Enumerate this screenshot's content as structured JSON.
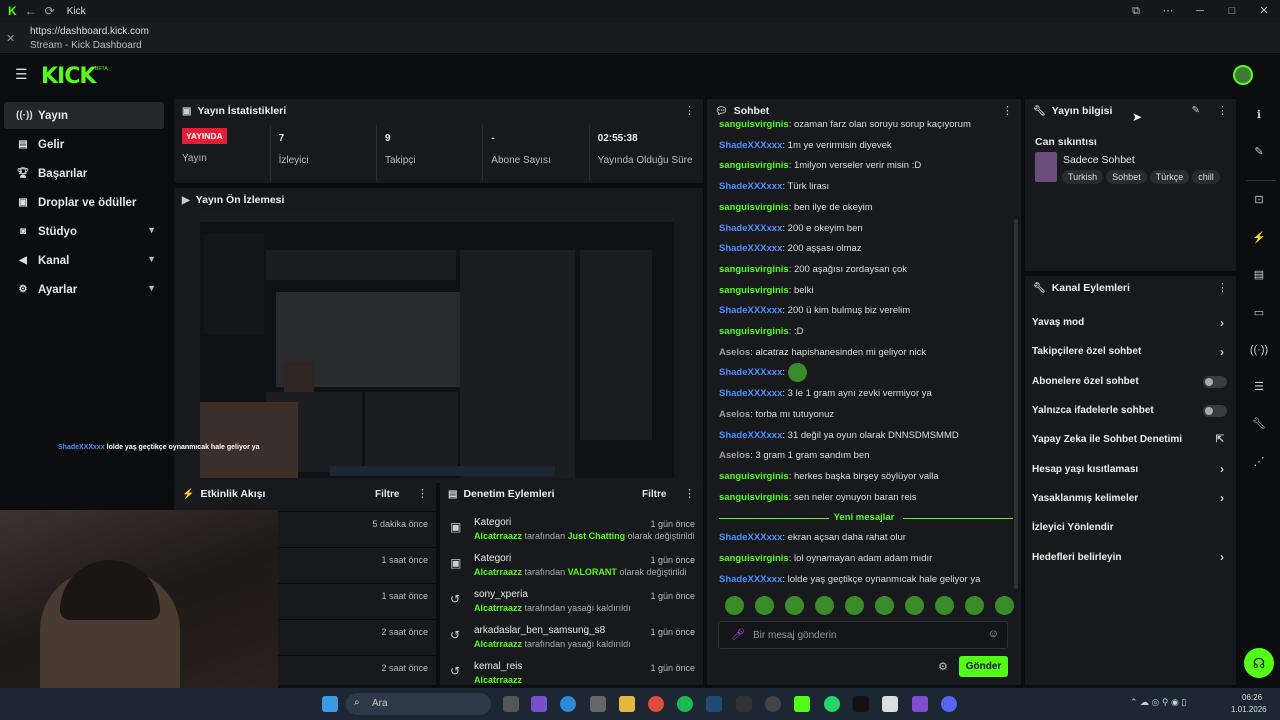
{
  "window": {
    "title": "Kick",
    "url": "https://dashboard.kick.com",
    "page_title": "Stream - Kick Dashboard"
  },
  "brand": {
    "logo": "KICK",
    "badge": "BETA",
    "accent": "#53fc18"
  },
  "sidebar": {
    "items": [
      {
        "icon": "broadcast-icon",
        "label": "Yayın",
        "active": true
      },
      {
        "icon": "revenue-icon",
        "label": "Gelir"
      },
      {
        "icon": "trophy-icon",
        "label": "Başarılar"
      },
      {
        "icon": "gift-icon",
        "label": "Droplar ve ödüller"
      },
      {
        "icon": "camera-icon",
        "label": "Stüdyo",
        "chevron": true
      },
      {
        "icon": "megaphone-icon",
        "label": "Kanal",
        "chevron": true
      },
      {
        "icon": "gear-icon",
        "label": "Ayarlar",
        "chevron": true
      }
    ]
  },
  "stats": {
    "title": "Yayın İstatistikleri",
    "live_badge": "YAYINDA",
    "items": [
      {
        "value": "",
        "label": "Yayın"
      },
      {
        "value": "7",
        "label": "İzleyici"
      },
      {
        "value": "9",
        "label": "Takipçi"
      },
      {
        "value": "-",
        "label": "Abone Sayısı"
      },
      {
        "value": "02:55:38",
        "label": "Yayında Olduğu Süre"
      }
    ]
  },
  "preview": {
    "title": "Yayın Ön İzlemesi",
    "overlay_user": "ShadeXXXxxx",
    "overlay_text": "lolde yaş geçtikçe oynanmıcak hale geliyor ya"
  },
  "activity": {
    "title": "Etkinlik Akışı",
    "filter": "Filtre",
    "rows": [
      "5 dakika önce",
      "1 saat önce",
      "1 saat önce",
      "2 saat önce",
      "2 saat önce"
    ]
  },
  "moderation": {
    "title": "Denetim Eylemleri",
    "filter": "Filtre",
    "rows": [
      {
        "name": "Kategori",
        "user": "Alcatrraazz",
        "mid": "tarafından",
        "value": "Just Chatting",
        "end": "olarak değiştirildi",
        "time": "1 gün önce"
      },
      {
        "name": "Kategori",
        "user": "Alcatrraazz",
        "mid": "tarafından",
        "value": "VALORANT",
        "end": "olarak değiştirildi",
        "time": "1 gün önce"
      },
      {
        "name": "sony_xperia",
        "user": "Alcatrraazz",
        "mid": "tarafından yasağı kaldırıldı",
        "value": "",
        "end": "",
        "time": "1 gün önce"
      },
      {
        "name": "arkadaslar_ben_samsung_s8",
        "user": "Alcatrraazz",
        "mid": "tarafından yasağı kaldırıldı",
        "value": "",
        "end": "",
        "time": "1 gün önce"
      },
      {
        "name": "kemal_reis",
        "user": "Alcatrraazz",
        "mid": "",
        "value": "",
        "end": "",
        "time": "1 gün önce"
      }
    ]
  },
  "chat": {
    "title": "Sohbet",
    "messages": [
      {
        "user": "sanguisvirginis",
        "color": "green",
        "text": "ozaman farz olan soruyu sorup kaçıyorum"
      },
      {
        "user": "ShadeXXXxxx",
        "color": "blue",
        "text": "1m ye verirmisin diyevek"
      },
      {
        "user": "sanguisvirginis",
        "color": "green",
        "text": "1milyon verseler verir misin :D"
      },
      {
        "user": "ShadeXXXxxx",
        "color": "blue",
        "text": "Türk lirası"
      },
      {
        "user": "sanguisvirginis",
        "color": "green",
        "text": "ben ilye de okeyim"
      },
      {
        "user": "ShadeXXXxxx",
        "color": "blue",
        "text": "200 e okeyim ben"
      },
      {
        "user": "ShadeXXXxxx",
        "color": "blue",
        "text": "200 aşşası olmaz"
      },
      {
        "user": "sanguisvirginis",
        "color": "green",
        "text": "200 aşağısı zordaysan çok"
      },
      {
        "user": "sanguisvirginis",
        "color": "green",
        "text": "belki"
      },
      {
        "user": "ShadeXXXxxx",
        "color": "blue",
        "text": "200 ü kim bulmuş biz verelim"
      },
      {
        "user": "sanguisvirginis",
        "color": "green",
        "text": ":D"
      },
      {
        "user": "Aselos",
        "color": "gray",
        "text": "alcatraz hapishanesinden mi geliyor nick"
      },
      {
        "user": "ShadeXXXxxx",
        "color": "blue",
        "text": ""
      },
      {
        "user": "ShadeXXXxxx",
        "color": "blue",
        "text": "3 le 1 gram aynı zevki vermiyor ya"
      },
      {
        "user": "Aselos",
        "color": "gray",
        "text": "torba mı tutuyonuz"
      },
      {
        "user": "ShadeXXXxxx",
        "color": "blue",
        "text": "31 değil ya oyun olarak DNNSDMSMMD"
      },
      {
        "user": "Aselos",
        "color": "gray",
        "text": "3 gram 1 gram sandım ben"
      },
      {
        "user": "sanguisvirginis",
        "color": "green",
        "text": "herkes başka birşey söylüyor valla"
      },
      {
        "user": "sanguisvirginis",
        "color": "green",
        "text": "sen neler oynuyon baran reis"
      }
    ],
    "new_messages_label": "Yeni mesajlar",
    "new_messages": [
      {
        "user": "ShadeXXXxxx",
        "color": "blue",
        "text": "ekran açsan daha rahat olur"
      },
      {
        "user": "sanguisvirginis",
        "color": "green",
        "text": "lol oynamayan adam adam mıdır"
      },
      {
        "user": "ShadeXXXxxx",
        "color": "blue",
        "text": "lolde yaş geçtikçe oynanmıcak hale geliyor ya"
      }
    ],
    "input_placeholder": "Bir mesaj gönderin",
    "send_label": "Gönder"
  },
  "stream_info": {
    "title": "Yayın bilgisi",
    "stream_title": "Can sıkıntısı",
    "category": "Sadece Sohbet",
    "tags": [
      "Turkish",
      "Sohbet",
      "Türkçe",
      "chill"
    ]
  },
  "channel_actions": {
    "title": "Kanal Eylemleri",
    "items": [
      {
        "label": "Yavaş mod",
        "control": "chevron"
      },
      {
        "label": "Takipçilere özel sohbet",
        "control": "chevron"
      },
      {
        "label": "Abonelere özel sohbet",
        "control": "toggle"
      },
      {
        "label": "Yalnızca ifadelerle sohbet",
        "control": "toggle"
      },
      {
        "label": "Yapay Zeka ile Sohbet Denetimi",
        "control": "external"
      },
      {
        "label": "Hesap yaşı kısıtlaması",
        "control": "chevron"
      },
      {
        "label": "Yasaklanmış kelimeler",
        "control": "chevron"
      },
      {
        "label": "İzleyici Yönlendir",
        "control": "none"
      },
      {
        "label": "Hedefleri belirleyin",
        "control": "chevron"
      }
    ]
  },
  "taskbar": {
    "search_placeholder": "Ara",
    "time": "06:26",
    "date": "1.01.2026"
  }
}
